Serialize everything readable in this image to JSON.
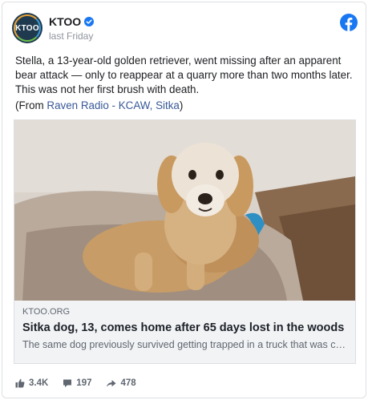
{
  "post": {
    "author": "KTOO",
    "avatar_text": "KTOO",
    "time": "last Friday",
    "body": "Stella, a 13-year-old golden retriever, went missing after an apparent bear attack — only to reappear at a quarry more than two months later. This was not her first brush with death.",
    "from_prefix": "(From ",
    "from_link": "Raven Radio - KCAW, Sitka",
    "from_suffix": ")"
  },
  "link_preview": {
    "domain": "KTOO.ORG",
    "title": "Sitka dog, 13, comes home after 65 days lost in the woods",
    "description": "The same dog previously survived getting trapped in a truck that was crushed"
  },
  "stats": {
    "likes": "3.4K",
    "comments": "197",
    "shares": "478"
  },
  "colors": {
    "facebook_blue": "#1877f2",
    "link_blue": "#385898",
    "muted_gray": "#606770"
  },
  "icons": {
    "verified": "verified-badge-icon",
    "facebook": "facebook-logo-icon",
    "like": "thumbs-up-icon",
    "comment": "comment-bubble-icon",
    "share": "share-arrow-icon"
  }
}
